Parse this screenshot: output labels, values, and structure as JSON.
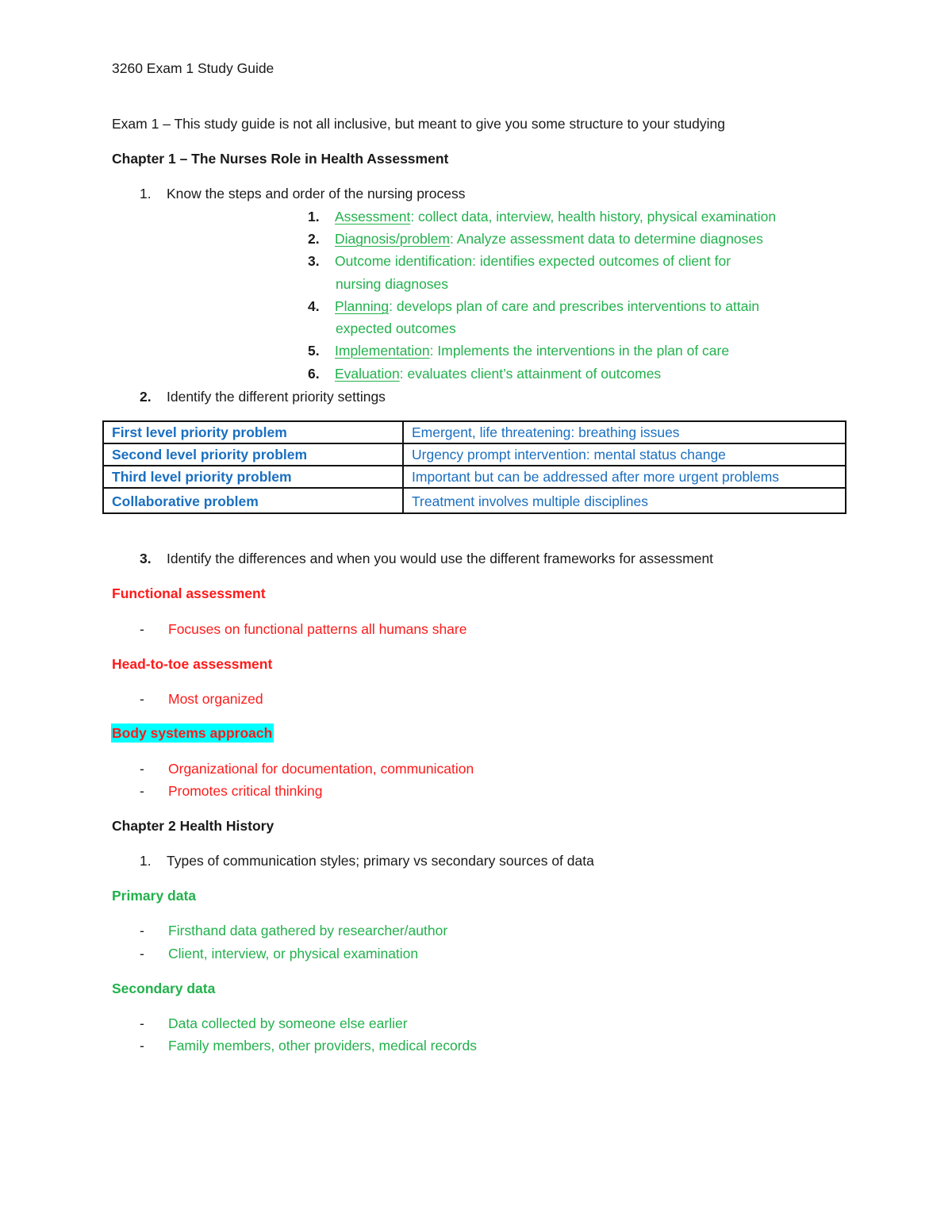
{
  "document": {
    "title": "3260 Exam 1 Study Guide",
    "intro": "Exam 1 – This study guide is not all inclusive, but meant to give you some structure to your studying",
    "chapter1": {
      "heading": "Chapter 1 – The Nurses Role in Health Assessment",
      "q1": {
        "num": "1.",
        "text": "Know the steps and order of the nursing process"
      },
      "nursing_process": [
        {
          "num": "1.",
          "term": "Assessment",
          "desc": ": collect data, interview, health history, physical examination",
          "cont": ""
        },
        {
          "num": "2.",
          "term": "Diagnosis/problem",
          "desc": ": Analyze assessment data to determine diagnoses",
          "cont": ""
        },
        {
          "num": "3.",
          "term": "Outcome identification",
          "desc": ": identifies expected outcomes of client for",
          "cont": "nursing diagnoses"
        },
        {
          "num": "4.",
          "term": "Planning",
          "desc": ": develops plan of care and prescribes interventions to attain",
          "cont": "expected outcomes"
        },
        {
          "num": "5.",
          "term": "Implementation",
          "desc": ": Implements the interventions in the plan of care",
          "cont": ""
        },
        {
          "num": "6.",
          "term": "Evaluation",
          "desc": ": evaluates client’s attainment of outcomes",
          "cont": ""
        }
      ],
      "q2": {
        "num": "2.",
        "text": "Identify the different priority settings"
      },
      "priority_table": [
        {
          "level": "First level priority problem",
          "description": "Emergent, life threatening: breathing issues"
        },
        {
          "level": "Second level priority problem",
          "description": "Urgency prompt intervention: mental status change"
        },
        {
          "level": "Third level priority problem",
          "description": "Important but can be addressed after more urgent problems"
        },
        {
          "level": "Collaborative problem",
          "description": "Treatment involves multiple disciplines"
        }
      ],
      "q3": {
        "num": "3.",
        "text": "Identify the differences and when you would use the different frameworks for assessment"
      },
      "frameworks": [
        {
          "heading": "Functional assessment",
          "highlight": false,
          "points": [
            "Focuses on functional patterns all humans share"
          ]
        },
        {
          "heading": "Head-to-toe assessment",
          "highlight": false,
          "points": [
            "Most organized"
          ]
        },
        {
          "heading": "Body systems approach",
          "highlight": true,
          "points": [
            "Organizational for documentation, communication",
            "Promotes critical thinking"
          ]
        }
      ]
    },
    "chapter2": {
      "heading": "Chapter 2 Health History",
      "q1": {
        "num": "1.",
        "text": "Types of communication styles; primary vs secondary sources of data"
      },
      "primary": {
        "heading": "Primary data",
        "points": [
          "Firsthand data gathered by researcher/author",
          "Client, interview, or physical examination"
        ]
      },
      "secondary": {
        "heading": "Secondary data",
        "points": [
          "Data collected by someone else earlier",
          "Family members, other providers, medical records"
        ]
      }
    },
    "bullet": "-"
  },
  "colors": {
    "green": "#22b14c",
    "red": "#ff1a1a",
    "blue": "#1a6fc0",
    "highlight": "#00ffff",
    "text": "#1a1a1a"
  }
}
